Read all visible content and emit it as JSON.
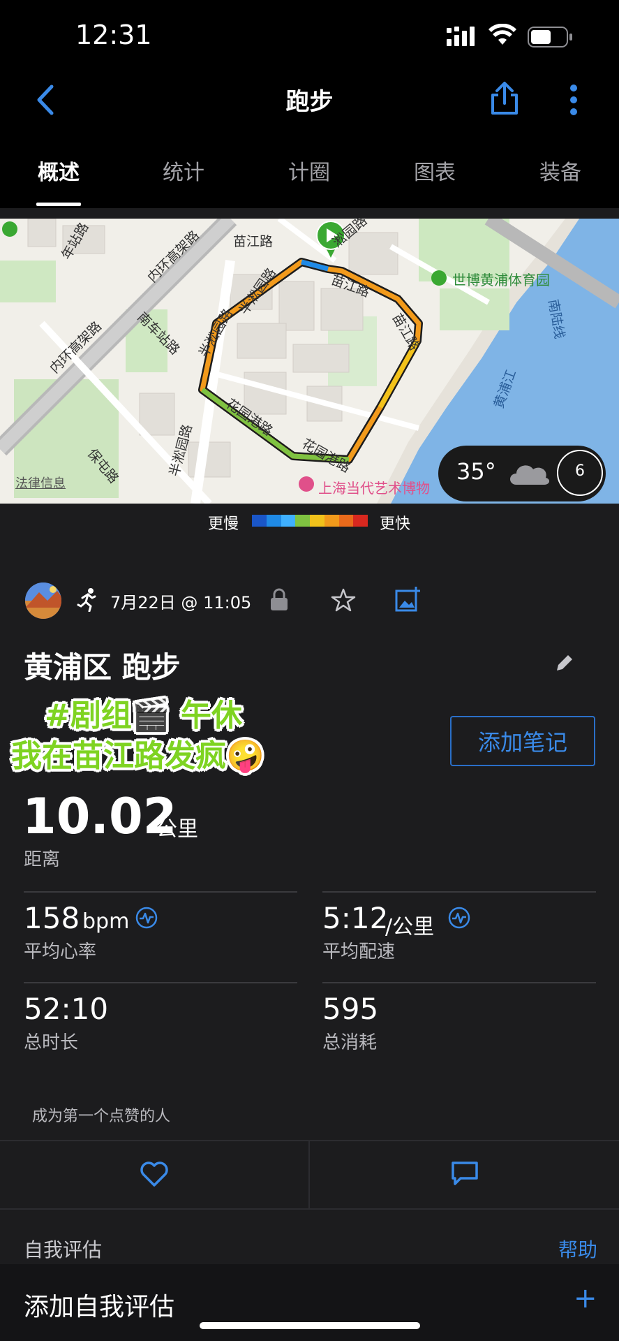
{
  "status_bar": {
    "time": "12:31"
  },
  "nav": {
    "title": "跑步",
    "back_icon": "chevron-left-icon",
    "share_icon": "share-icon",
    "more_icon": "more-vertical-icon"
  },
  "tabs": [
    {
      "label": "概述",
      "active": true
    },
    {
      "label": "统计",
      "active": false
    },
    {
      "label": "计圈",
      "active": false
    },
    {
      "label": "图表",
      "active": false
    },
    {
      "label": "装备",
      "active": false
    }
  ],
  "map": {
    "labels": {
      "l1": "年站路",
      "l2": "内环高架路",
      "l3": "内环高架路",
      "l4": "苗江路",
      "l5": "半淞园路",
      "l6": "南车站路",
      "l7": "世博黄浦体育园",
      "l8": "苗江路",
      "l9": "南陆线",
      "l10": "黄浦江",
      "l11": "花园港路",
      "l12": "花园港路",
      "l13": "保屯路",
      "l14": "半淞园路",
      "l15": "上海当代艺术博物",
      "l16": "淞园路",
      "l17": "苗江路",
      "l18": "半淞园路"
    },
    "legal_link": "法律信息",
    "weather": {
      "temp": "35°",
      "icon": "cloud-icon",
      "wind": "6"
    }
  },
  "legend": {
    "slow": "更慢",
    "fast": "更快",
    "colors": [
      "#1a56c8",
      "#1f8ae6",
      "#3fb0ff",
      "#7fc241",
      "#f2c21b",
      "#f29a1b",
      "#ea6a1b",
      "#d8281f"
    ]
  },
  "activity": {
    "date": "7月22日 @ 11:05",
    "title": "黄浦区 跑步",
    "sticker_line1": "#剧组🎬 午休",
    "sticker_line2": "我在苗江路发疯🤪",
    "add_note": "添加笔记",
    "distance": {
      "value": "10.02",
      "unit": "公里",
      "label": "距离"
    },
    "heart_rate": {
      "value": "158",
      "unit": "bpm",
      "label": "平均心率"
    },
    "pace": {
      "value": "5:12",
      "unit": "/公里",
      "label": "平均配速"
    },
    "duration": {
      "value": "52:10",
      "label": "总时长"
    },
    "calories": {
      "value": "595",
      "label": "总消耗"
    },
    "likes_text": "成为第一个点赞的人"
  },
  "self_eval": {
    "label": "自我评估",
    "help": "帮助",
    "add": "添加自我评估",
    "plus": "+"
  }
}
